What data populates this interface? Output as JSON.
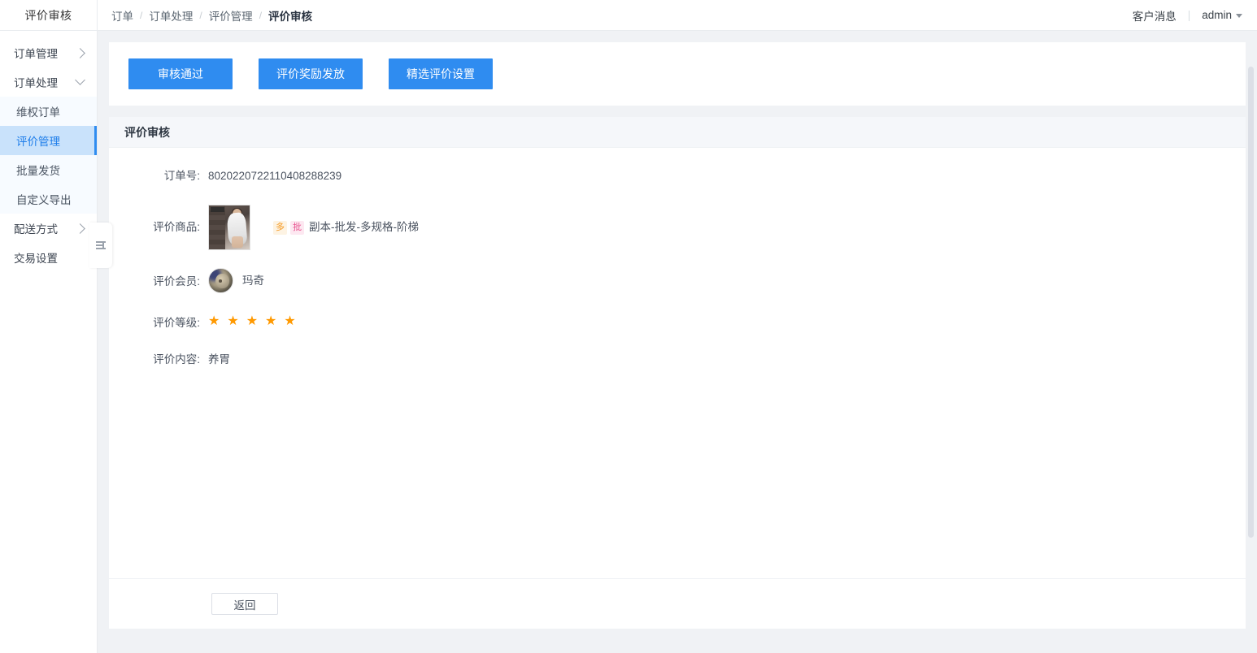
{
  "header": {
    "brand": "评价审核",
    "breadcrumb": [
      {
        "label": "订单",
        "active": false
      },
      {
        "label": "订单处理",
        "active": false
      },
      {
        "label": "评价管理",
        "active": false
      },
      {
        "label": "评价审核",
        "active": true
      }
    ],
    "separator": "/",
    "messages_label": "客户消息",
    "divider": "|",
    "user": "admin",
    "caret_icon": "chevron-down-icon"
  },
  "sidebar": {
    "groups": [
      {
        "label": "订单管理",
        "expanded": false,
        "icon": "chevron-right-icon"
      },
      {
        "label": "订单处理",
        "expanded": true,
        "icon": "chevron-down-icon"
      }
    ],
    "submenu": [
      {
        "label": "维权订单",
        "active": false
      },
      {
        "label": "评价管理",
        "active": true
      },
      {
        "label": "批量发货",
        "active": false
      },
      {
        "label": "自定义导出",
        "active": false
      }
    ],
    "groups_after": [
      {
        "label": "配送方式",
        "expanded": false,
        "icon": "chevron-right-icon"
      },
      {
        "label": "交易设置",
        "expanded": false,
        "icon": ""
      }
    ],
    "collapse_handle_icon": "menu-list-icon"
  },
  "toolbar": {
    "buttons": [
      {
        "label": "审核通过"
      },
      {
        "label": "评价奖励发放"
      },
      {
        "label": "精选评价设置"
      }
    ]
  },
  "panel": {
    "title": "评价审核",
    "fields": {
      "order_no_label": "订单号:",
      "order_no_value": "8020220722110408288239",
      "product_label": "评价商品:",
      "product_tags": [
        {
          "text": "多",
          "kind": "duo"
        },
        {
          "text": "批",
          "kind": "pi"
        }
      ],
      "product_name": "副本-批发-多规格-阶梯",
      "product_thumb_icon": "product-thumbnail",
      "member_label": "评价会员:",
      "member_name": "玛奇",
      "member_avatar_icon": "avatar",
      "rating_label": "评价等级:",
      "rating_value": 5,
      "rating_max": 5,
      "star_icon": "star-icon",
      "content_label": "评价内容:",
      "content_value": "养胃"
    }
  },
  "footer": {
    "back_label": "返回"
  },
  "colors": {
    "primary": "#2f8cf0",
    "active_menu_bg": "#c9e2fb",
    "active_menu_text": "#1d7dea",
    "star": "#ff9900",
    "tag_duo": "#f59a23",
    "tag_pi": "#e8538f",
    "content_bg": "#f0f2f5"
  }
}
